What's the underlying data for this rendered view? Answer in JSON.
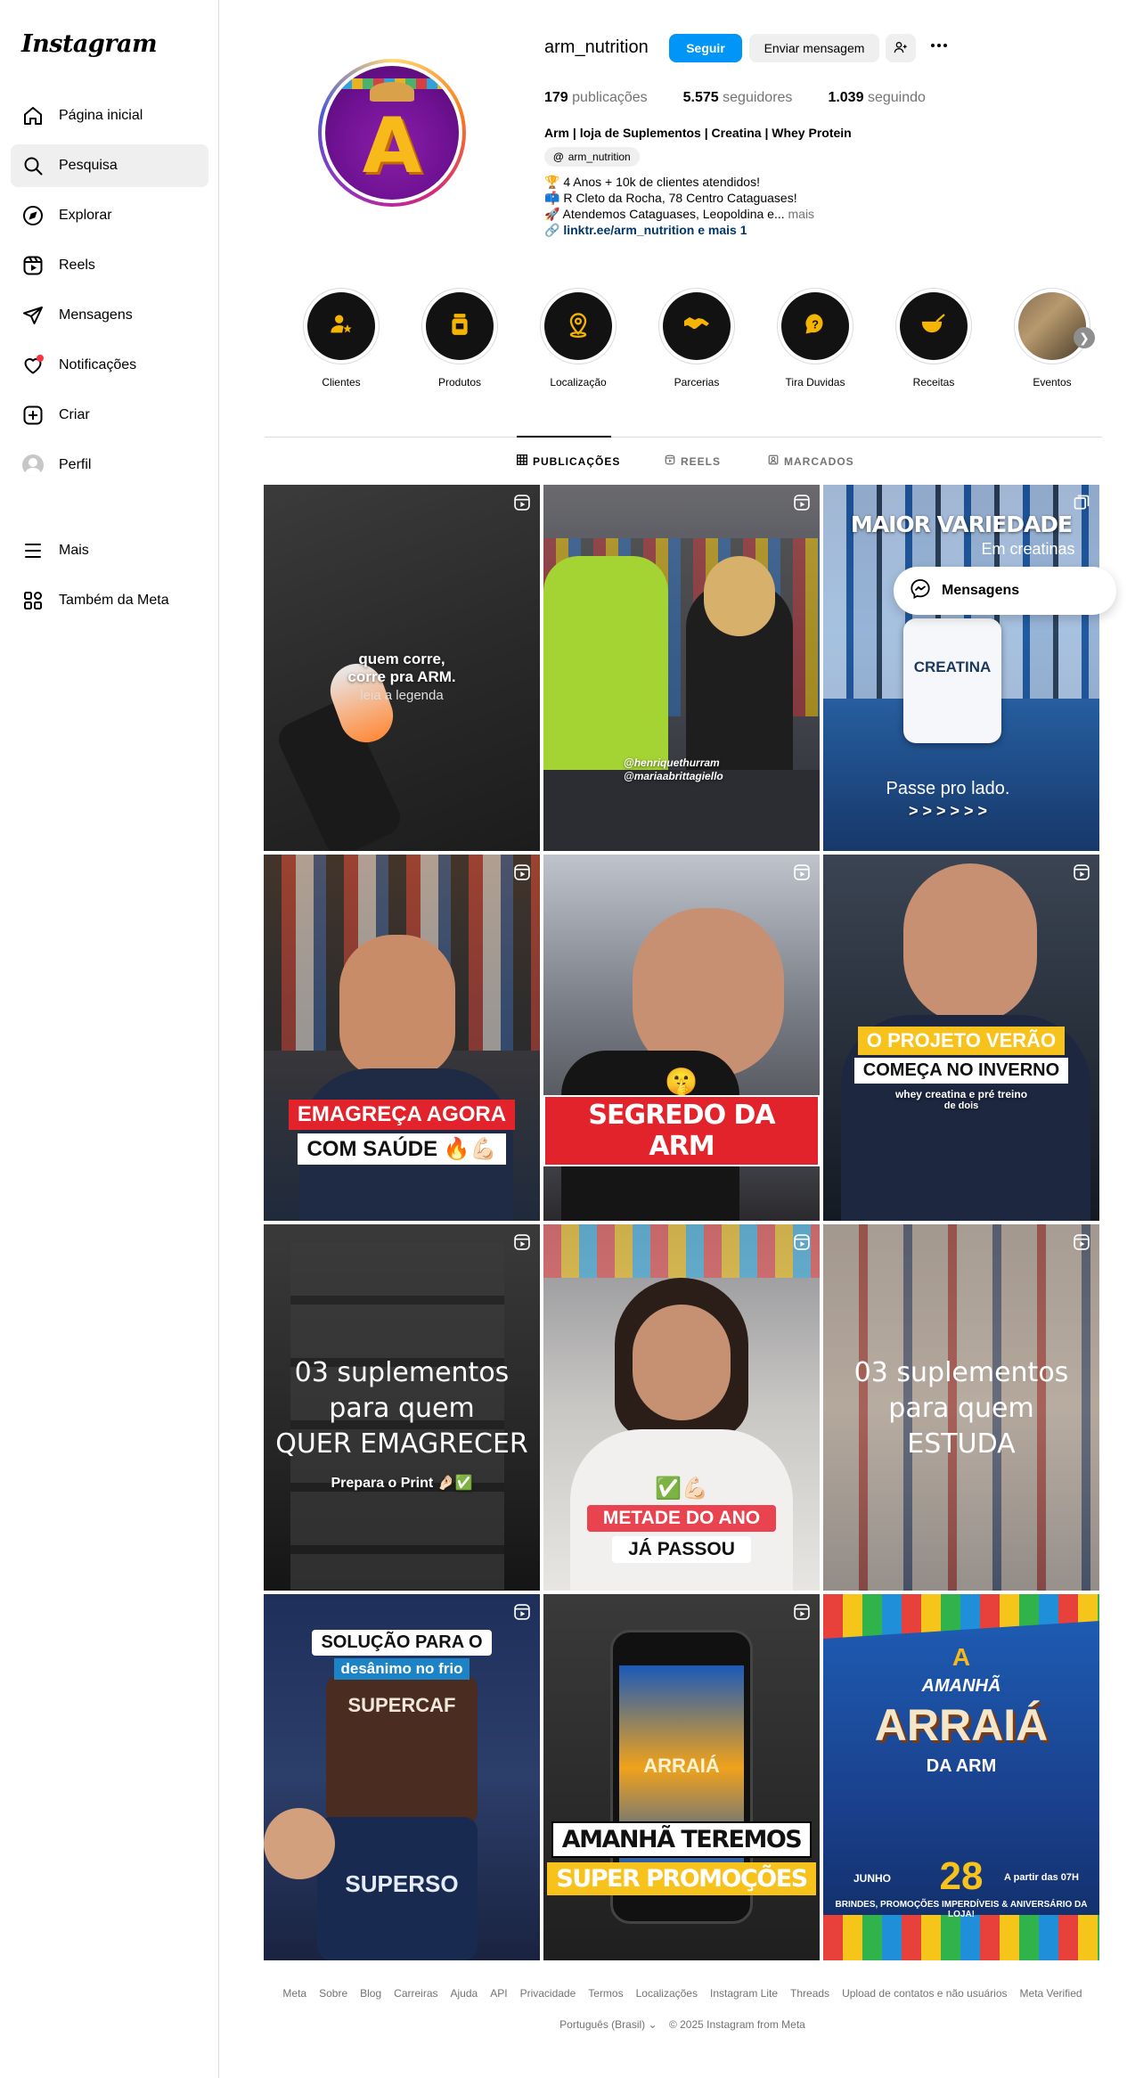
{
  "app": {
    "logo": "Instagram"
  },
  "sidebar": {
    "items": [
      {
        "label": "Página inicial",
        "icon": "home-icon"
      },
      {
        "label": "Pesquisa",
        "icon": "search-icon",
        "active": true
      },
      {
        "label": "Explorar",
        "icon": "compass-icon"
      },
      {
        "label": "Reels",
        "icon": "reels-icon"
      },
      {
        "label": "Mensagens",
        "icon": "send-icon"
      },
      {
        "label": "Notificações",
        "icon": "heart-icon"
      },
      {
        "label": "Criar",
        "icon": "plus-square-icon"
      },
      {
        "label": "Perfil",
        "icon": "avatar-icon"
      }
    ],
    "more_label": "Mais",
    "meta_label": "Também da Meta"
  },
  "profile": {
    "username": "arm_nutrition",
    "follow_label": "Seguir",
    "message_label": "Enviar mensagem",
    "posts_count": "179",
    "posts_label": "publicações",
    "followers_count": "5.575",
    "followers_label": "seguidores",
    "following_count": "1.039",
    "following_label": "seguindo",
    "bio_name": "Arm | loja de Suplementos | Creatina | Whey Protein",
    "threads_handle": "arm_nutrition",
    "bio_lines": [
      "🏆 4 Anos + 10k de clientes atendidos!",
      "📫 R Cleto da Rocha, 78 Centro Cataguases!",
      "🚀 Atendemos Cataguases, Leopoldina e..."
    ],
    "bio_more": "mais",
    "bio_link": "linktr.ee/arm_nutrition e mais 1",
    "avatar_letter": "A"
  },
  "highlights": [
    {
      "label": "Clientes",
      "icon": "person-star-icon"
    },
    {
      "label": "Produtos",
      "icon": "supplement-jar-icon"
    },
    {
      "label": "Localização",
      "icon": "location-pin-icon"
    },
    {
      "label": "Parcerias",
      "icon": "handshake-icon"
    },
    {
      "label": "Tira Duvidas",
      "icon": "question-bubble-icon"
    },
    {
      "label": "Receitas",
      "icon": "mixing-bowl-icon"
    },
    {
      "label": "Eventos",
      "icon": "photo-thumbnail"
    }
  ],
  "tabs": [
    {
      "label": "PUBLICAÇÕES",
      "icon": "grid-icon",
      "active": true
    },
    {
      "label": "REELS",
      "icon": "reels-icon"
    },
    {
      "label": "MARCADOS",
      "icon": "tag-icon"
    }
  ],
  "posts": [
    {
      "type": "reel",
      "lines": [
        "quem corre,",
        "corre pra ARM.",
        "leia a legenda"
      ]
    },
    {
      "type": "reel",
      "lines": [
        "@henriquethurram",
        "@mariaabrittagiello"
      ]
    },
    {
      "type": "carousel",
      "lines": [
        "MAIOR VARIEDADE",
        "Em creatinas",
        "CREATINA",
        "Passe pro lado.",
        "> > > > > >"
      ]
    },
    {
      "type": "reel",
      "lines": [
        "EMAGREÇA AGORA",
        "COM SAÚDE 🔥💪🏻"
      ]
    },
    {
      "type": "reel",
      "lines": [
        "SEGREDO DA ARM",
        "🤫"
      ]
    },
    {
      "type": "reel",
      "lines": [
        "O PROJETO VERÃO",
        "COMEÇA NO INVERNO",
        "whey creatina e pré treino",
        "de dois"
      ]
    },
    {
      "type": "reel",
      "lines": [
        "03 suplementos",
        "para quem",
        "QUER EMAGRECER",
        "Prepara o Print 🤌🏻✅"
      ]
    },
    {
      "type": "reel",
      "lines": [
        "✅💪🏻",
        "METADE DO ANO",
        "JÁ PASSOU"
      ]
    },
    {
      "type": "reel",
      "lines": [
        "03 suplementos",
        "para quem",
        "ESTUDA"
      ]
    },
    {
      "type": "reel",
      "lines": [
        "SOLUÇÃO PARA O",
        "desânimo no frio",
        "SUPERCAF",
        "SUPERSO"
      ]
    },
    {
      "type": "reel",
      "lines": [
        "AMANHÃ TEREMOS",
        "SUPER PROMOÇÕES",
        "ARRAIÁ"
      ]
    },
    {
      "type": "image",
      "lines": [
        "A",
        "AMANHÃ",
        "ARRAIÁ",
        "DA ARM",
        "JUNHO",
        "28",
        "A partir das 07H",
        "BRINDES, PROMOÇÕES IMPERDÍVEIS & ANIVERSÁRIO DA LOJA!"
      ]
    }
  ],
  "floating": {
    "messages_label": "Mensagens"
  },
  "footer": {
    "links": [
      "Meta",
      "Sobre",
      "Blog",
      "Carreiras",
      "Ajuda",
      "API",
      "Privacidade",
      "Termos",
      "Localizações",
      "Instagram Lite",
      "Threads",
      "Upload de contatos e não usuários",
      "Meta Verified"
    ],
    "language": "Português (Brasil)",
    "copyright": "© 2025 Instagram from Meta"
  },
  "colors": {
    "accent": "#0095f6",
    "notification": "#ff3040",
    "link": "#00376b"
  }
}
